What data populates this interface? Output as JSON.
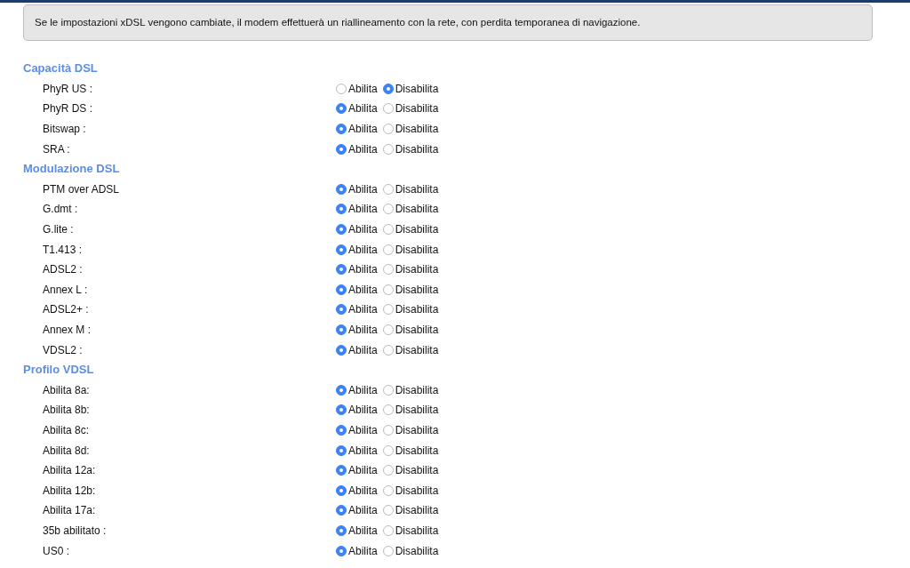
{
  "notice": "Se le impostazioni xDSL vengono cambiate, il modem effettuerà un riallineamento con la rete, con perdita temporanea di navigazione.",
  "sections": [
    {
      "title": "Capacità DSL",
      "rows": [
        {
          "label": "PhyR US :",
          "options": [
            {
              "label": "Abilita",
              "selected": false
            },
            {
              "label": "Disabilita",
              "selected": true
            }
          ]
        },
        {
          "label": "PhyR DS :",
          "options": [
            {
              "label": "Abilita",
              "selected": true
            },
            {
              "label": "Disabilita",
              "selected": false
            }
          ]
        },
        {
          "label": "Bitswap :",
          "options": [
            {
              "label": "Abilita",
              "selected": true
            },
            {
              "label": "Disabilita",
              "selected": false
            }
          ]
        },
        {
          "label": "SRA :",
          "options": [
            {
              "label": "Abilita",
              "selected": true
            },
            {
              "label": "Disabilita",
              "selected": false
            }
          ]
        }
      ]
    },
    {
      "title": "Modulazione DSL",
      "rows": [
        {
          "label": "PTM over ADSL",
          "options": [
            {
              "label": "Abilita",
              "selected": true
            },
            {
              "label": "Disabilita",
              "selected": false
            }
          ]
        },
        {
          "label": "G.dmt :",
          "options": [
            {
              "label": "Abilita",
              "selected": true
            },
            {
              "label": "Disabilita",
              "selected": false
            }
          ]
        },
        {
          "label": "G.lite :",
          "options": [
            {
              "label": "Abilita",
              "selected": true
            },
            {
              "label": "Disabilita",
              "selected": false
            }
          ]
        },
        {
          "label": "T1.413 :",
          "options": [
            {
              "label": "Abilita",
              "selected": true
            },
            {
              "label": "Disabilita",
              "selected": false
            }
          ]
        },
        {
          "label": "ADSL2 :",
          "options": [
            {
              "label": "Abilita",
              "selected": true
            },
            {
              "label": "Disabilita",
              "selected": false
            }
          ]
        },
        {
          "label": "Annex L :",
          "options": [
            {
              "label": "Abilita",
              "selected": true
            },
            {
              "label": "Disabilita",
              "selected": false
            }
          ]
        },
        {
          "label": "ADSL2+ :",
          "options": [
            {
              "label": "Abilita",
              "selected": true
            },
            {
              "label": "Disabilita",
              "selected": false
            }
          ]
        },
        {
          "label": "Annex M :",
          "options": [
            {
              "label": "Abilita",
              "selected": true
            },
            {
              "label": "Disabilita",
              "selected": false
            }
          ]
        },
        {
          "label": "VDSL2 :",
          "options": [
            {
              "label": "Abilita",
              "selected": true
            },
            {
              "label": "Disabilita",
              "selected": false
            }
          ]
        }
      ]
    },
    {
      "title": "Profilo VDSL",
      "rows": [
        {
          "label": "Abilita 8a:",
          "options": [
            {
              "label": "Abilita",
              "selected": true
            },
            {
              "label": "Disabilita",
              "selected": false
            }
          ]
        },
        {
          "label": "Abilita 8b:",
          "options": [
            {
              "label": "Abilita",
              "selected": true
            },
            {
              "label": "Disabilita",
              "selected": false
            }
          ]
        },
        {
          "label": "Abilita 8c:",
          "options": [
            {
              "label": "Abilita",
              "selected": true
            },
            {
              "label": "Disabilita",
              "selected": false
            }
          ]
        },
        {
          "label": "Abilita 8d:",
          "options": [
            {
              "label": "Abilita",
              "selected": true
            },
            {
              "label": "Disabilita",
              "selected": false
            }
          ]
        },
        {
          "label": "Abilita 12a:",
          "options": [
            {
              "label": "Abilita",
              "selected": true
            },
            {
              "label": "Disabilita",
              "selected": false
            }
          ]
        },
        {
          "label": "Abilita 12b:",
          "options": [
            {
              "label": "Abilita",
              "selected": true
            },
            {
              "label": "Disabilita",
              "selected": false
            }
          ]
        },
        {
          "label": "Abilita 17a:",
          "options": [
            {
              "label": "Abilita",
              "selected": true
            },
            {
              "label": "Disabilita",
              "selected": false
            }
          ]
        },
        {
          "label": "35b abilitato :",
          "options": [
            {
              "label": "Abilita",
              "selected": true
            },
            {
              "label": "Disabilita",
              "selected": false
            }
          ]
        },
        {
          "label": "US0 :",
          "options": [
            {
              "label": "Abilita",
              "selected": true
            },
            {
              "label": "Disabilita",
              "selected": false
            }
          ]
        }
      ]
    }
  ]
}
